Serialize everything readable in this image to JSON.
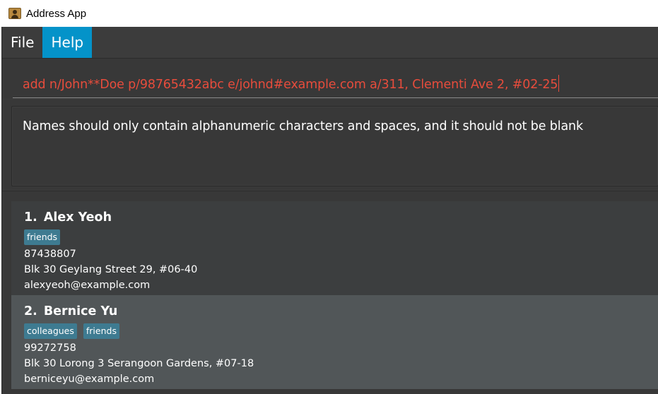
{
  "window": {
    "title": "Address App"
  },
  "menu": {
    "items": [
      "File",
      "Help"
    ]
  },
  "command": {
    "value": "add n/John**Doe p/98765432abc e/johnd#example.com a/311, Clementi Ave 2, #02-25"
  },
  "result": {
    "message": "Names should only contain alphanumeric characters and spaces, and it should not be blank"
  },
  "persons": [
    {
      "index": "1.",
      "name": "Alex Yeoh",
      "tags": [
        "friends"
      ],
      "phone": "87438807",
      "address": "Blk 30 Geylang Street 29, #06-40",
      "email": "alexyeoh@example.com"
    },
    {
      "index": "2.",
      "name": "Bernice Yu",
      "tags": [
        "colleagues",
        "friends"
      ],
      "phone": "99272758",
      "address": "Blk 30 Lorong 3 Serangoon Gardens, #07-18",
      "email": "berniceyu@example.com"
    }
  ],
  "colors": {
    "menu_active": "#0493c9",
    "error_text": "#e74c3c",
    "tag_bg": "#3e7b91"
  },
  "icons": {
    "app": "address-book-icon"
  }
}
